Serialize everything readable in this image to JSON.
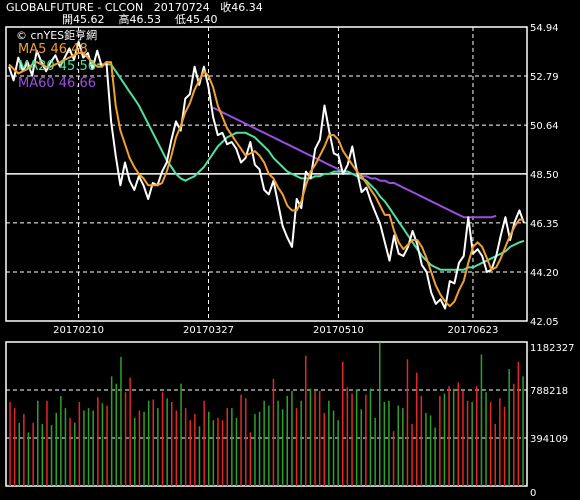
{
  "header": {
    "symbol": "GLOBALFUTURE - CLCON",
    "date": "20170724",
    "close": "收46.34",
    "open": "開45.62",
    "high": "高46.53",
    "low": "低45.40"
  },
  "watermark": "© cnYES鉅亨網",
  "ma_labels": {
    "ma5": "MA5 46.48",
    "ma20": "MA20 45.56",
    "ma60": "MA60 46.66"
  },
  "colors": {
    "price": "#ffffff",
    "ma5": "#f0a030",
    "ma20": "#50e0a0",
    "ma60": "#9a4fe0",
    "up_bar": "#e02828",
    "down_bar": "#2ea02e",
    "grid": "#ffffff",
    "background": "#000000"
  },
  "chart_data": [
    {
      "type": "line",
      "name": "price",
      "ylim": [
        42.05,
        54.94
      ],
      "y_ticks": [
        "54.94",
        "52.79",
        "50.64",
        "48.50",
        "46.35",
        "44.20",
        "42.05"
      ],
      "x_ticks": [
        "20170210",
        "20170327",
        "20170510",
        "20170623"
      ],
      "series": [
        {
          "name": "MA5 46.48",
          "values": [
            53.3,
            53.1,
            52.9,
            53.0,
            53.1,
            53.3,
            53.4,
            53.3,
            53.2,
            53.2,
            53.3,
            53.4,
            53.5,
            53.6,
            53.7,
            53.8,
            53.8,
            53.6,
            53.4,
            53.2,
            53.2,
            53.4,
            53.4,
            51.5,
            50.4,
            49.8,
            49.2,
            48.8,
            48.5,
            48.3,
            48.0,
            48.0,
            48.0,
            48.1,
            48.6,
            49.3,
            50.1,
            50.6,
            51.2,
            51.6,
            52.2,
            52.6,
            53.0,
            52.8,
            52.3,
            51.5,
            51.0,
            50.5,
            50.2,
            49.9,
            49.6,
            49.3,
            49.4,
            49.5,
            49.3,
            49.0,
            48.5,
            48.3,
            47.9,
            47.6,
            47.1,
            46.9,
            46.9,
            47.3,
            48.0,
            48.6,
            48.9,
            49.3,
            49.7,
            50.2,
            50.2,
            50.0,
            49.5,
            49.2,
            48.9,
            48.6,
            48.4,
            48.1,
            47.8,
            47.5,
            47.1,
            46.7,
            46.7,
            46.0,
            45.5,
            45.2,
            45.4,
            45.6,
            45.6,
            45.3,
            44.8,
            44.2,
            43.6,
            43.2,
            42.9,
            42.7,
            42.9,
            43.4,
            43.8,
            44.6,
            45.3,
            45.5,
            45.3,
            44.8,
            44.3,
            44.4,
            44.8,
            45.3,
            45.8,
            46.2,
            46.5,
            46.48
          ]
        },
        {
          "name": "MA20 45.56",
          "values": [
            null,
            null,
            null,
            null,
            null,
            null,
            null,
            null,
            null,
            null,
            null,
            null,
            null,
            null,
            null,
            null,
            null,
            null,
            null,
            53.3,
            53.3,
            53.3,
            53.3,
            53.0,
            52.7,
            52.4,
            52.1,
            51.8,
            51.5,
            51.1,
            50.7,
            50.3,
            49.9,
            49.5,
            49.1,
            48.8,
            48.5,
            48.3,
            48.2,
            48.3,
            48.4,
            48.6,
            48.8,
            49.1,
            49.4,
            49.7,
            49.9,
            50.1,
            50.2,
            50.3,
            50.3,
            50.3,
            50.2,
            50.1,
            49.9,
            49.7,
            49.5,
            49.2,
            49.0,
            48.8,
            48.6,
            48.5,
            48.4,
            48.3,
            48.3,
            48.3,
            48.4,
            48.4,
            48.5,
            48.5,
            48.6,
            48.6,
            48.6,
            48.6,
            48.5,
            48.4,
            48.3,
            48.2,
            48.0,
            47.8,
            47.5,
            47.3,
            47.0,
            46.7,
            46.4,
            46.1,
            45.8,
            45.5,
            45.2,
            44.9,
            44.7,
            44.5,
            44.4,
            44.3,
            44.3,
            44.3,
            44.3,
            44.3,
            44.3,
            44.4,
            44.4,
            44.5,
            44.6,
            44.7,
            44.8,
            44.9,
            45.0,
            45.1,
            45.3,
            45.4,
            45.5,
            45.56
          ]
        },
        {
          "name": "MA60 46.66",
          "values": [
            null,
            null,
            null,
            null,
            null,
            null,
            null,
            null,
            null,
            null,
            null,
            null,
            null,
            null,
            null,
            null,
            null,
            null,
            null,
            null,
            null,
            null,
            null,
            null,
            null,
            null,
            null,
            null,
            null,
            null,
            null,
            null,
            null,
            null,
            null,
            null,
            null,
            null,
            null,
            null,
            null,
            null,
            null,
            null,
            51.4,
            51.3,
            51.2,
            51.1,
            51.0,
            50.9,
            50.8,
            50.7,
            50.6,
            50.5,
            50.4,
            50.3,
            50.2,
            50.1,
            50.0,
            49.9,
            49.8,
            49.7,
            49.6,
            49.5,
            49.4,
            49.3,
            49.2,
            49.1,
            49.0,
            48.9,
            48.8,
            48.7,
            48.6,
            48.6,
            48.5,
            48.5,
            48.4,
            48.4,
            48.3,
            48.3,
            48.2,
            48.2,
            48.1,
            48.1,
            48.0,
            47.9,
            47.8,
            47.7,
            47.6,
            47.5,
            47.4,
            47.3,
            47.2,
            47.1,
            47.0,
            46.9,
            46.8,
            46.7,
            46.6,
            46.6,
            46.6,
            46.6,
            46.6,
            46.6,
            46.6,
            46.66
          ]
        },
        {
          "name": "price",
          "values": [
            53.2,
            52.6,
            53.6,
            53.0,
            53.4,
            52.8,
            53.9,
            53.4,
            53.0,
            53.4,
            53.7,
            53.2,
            53.6,
            54.0,
            53.5,
            54.3,
            53.6,
            53.8,
            53.1,
            53.9,
            53.2,
            53.4,
            50.8,
            49.3,
            48.0,
            49.0,
            48.2,
            47.8,
            48.4,
            48.0,
            47.4,
            48.1,
            48.0,
            48.6,
            49.0,
            50.0,
            50.8,
            50.4,
            51.8,
            52.0,
            53.2,
            52.4,
            53.2,
            52.3,
            51.0,
            50.2,
            50.3,
            49.8,
            49.9,
            49.6,
            49.0,
            49.2,
            49.9,
            48.9,
            48.7,
            47.8,
            47.6,
            48.2,
            47.2,
            46.2,
            45.7,
            45.3,
            47.4,
            47.0,
            48.6,
            48.3,
            49.6,
            50.0,
            51.5,
            50.4,
            49.4,
            49.3,
            48.5,
            48.9,
            49.7,
            48.6,
            47.7,
            47.9,
            47.3,
            46.8,
            46.3,
            45.5,
            44.7,
            45.8,
            45.0,
            44.9,
            45.3,
            46.0,
            45.4,
            44.5,
            44.2,
            43.3,
            42.8,
            43.0,
            42.6,
            43.8,
            43.7,
            44.6,
            44.9,
            46.6,
            45.0,
            45.2,
            44.9,
            44.2,
            44.3,
            44.9,
            45.8,
            46.6,
            45.6,
            46.4,
            46.9,
            46.34
          ]
        }
      ]
    },
    {
      "type": "bar",
      "name": "volume",
      "ylim": [
        0,
        1182327
      ],
      "y_ticks": [
        "1182327",
        "788218",
        "394109",
        "0"
      ],
      "values": [
        690000,
        640000,
        520000,
        590000,
        440000,
        520000,
        700000,
        510000,
        700000,
        500000,
        600000,
        740000,
        640000,
        560000,
        520000,
        690000,
        620000,
        640000,
        620000,
        730000,
        680000,
        660000,
        900000,
        840000,
        1060000,
        770000,
        890000,
        560000,
        620000,
        610000,
        700000,
        710000,
        640000,
        770000,
        720000,
        690000,
        620000,
        840000,
        640000,
        540000,
        590000,
        490000,
        700000,
        610000,
        540000,
        560000,
        540000,
        640000,
        640000,
        560000,
        750000,
        720000,
        440000,
        590000,
        610000,
        700000,
        660000,
        880000,
        700000,
        630000,
        740000,
        780000,
        640000,
        700000,
        1070000,
        800000,
        780000,
        780000,
        600000,
        700000,
        620000,
        540000,
        1020000,
        810000,
        760000,
        790000,
        630000,
        750000,
        800000,
        560000,
        1180000,
        690000,
        700000,
        450000,
        660000,
        640000,
        1040000,
        510000,
        930000,
        740000,
        600000,
        580000,
        480000,
        740000,
        760000,
        820000,
        800000,
        850000,
        780000,
        700000,
        690000,
        820000,
        1080000,
        770000,
        690000,
        510000,
        720000,
        650000,
        960000,
        840000,
        1020000,
        900000
      ],
      "up": [
        1,
        1,
        0,
        1,
        0,
        1,
        0,
        0,
        1,
        0,
        0,
        0,
        0,
        1,
        0,
        1,
        0,
        0,
        0,
        1,
        0,
        1,
        0,
        0,
        0,
        1,
        1,
        0,
        1,
        0,
        0,
        1,
        0,
        1,
        0,
        1,
        1,
        0,
        1,
        1,
        1,
        0,
        1,
        0,
        0,
        1,
        1,
        1,
        0,
        0,
        1,
        1,
        1,
        0,
        0,
        0,
        0,
        1,
        0,
        0,
        0,
        0,
        1,
        0,
        1,
        0,
        1,
        1,
        1,
        0,
        0,
        0,
        1,
        1,
        1,
        0,
        0,
        1,
        0,
        0,
        0,
        0,
        0,
        1,
        0,
        0,
        1,
        1,
        1,
        1,
        0,
        0,
        0,
        1,
        0,
        1,
        0,
        1,
        1,
        1,
        0,
        1,
        0,
        0,
        1,
        1,
        1,
        1,
        0,
        1,
        1,
        0
      ]
    }
  ]
}
